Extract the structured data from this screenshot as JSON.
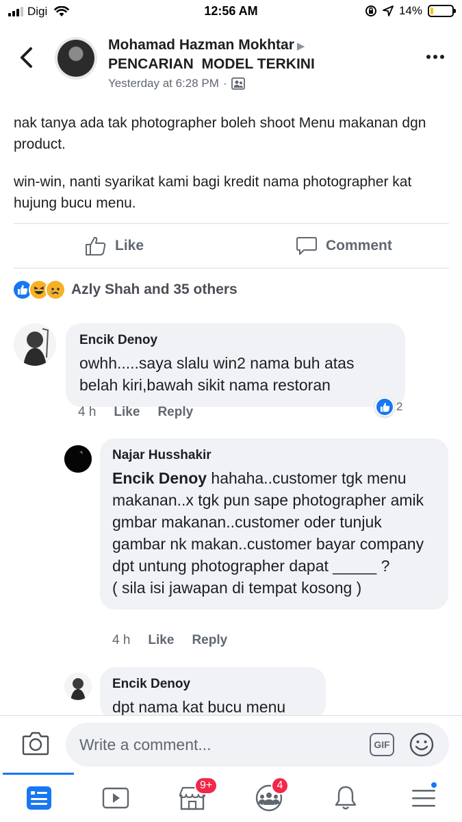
{
  "status_bar": {
    "carrier": "Digi",
    "time": "12:56 AM",
    "battery": "14%",
    "battery_level": 0.14,
    "battery_color": "#f5c400"
  },
  "header": {
    "back_icon": "chevron-left-icon",
    "author": "Mohamad Hazman Mokhtar",
    "arrow": "▶",
    "group": "PENCARIAN  MODEL TERKINI",
    "time": "Yesterday at 6:28 PM",
    "separator": "·",
    "privacy_icon": "members-icon",
    "more_icon": "more-icon"
  },
  "post": {
    "paragraphs": [
      "nak tanya ada tak photographer boleh shoot Menu makanan dgn product.",
      "win-win, nanti syarikat kami bagi kredit nama photographer kat hujung bucu menu."
    ]
  },
  "actions": {
    "like": "Like",
    "comment": "Comment"
  },
  "reactions": {
    "icons": [
      "like-reaction-icon",
      "haha-reaction-icon",
      "sad-reaction-icon"
    ],
    "summary": "Azly Shah and 35 others"
  },
  "comments": [
    {
      "name": "Encik Denoy",
      "text": "owhh.....saya slalu win2 nama buh atas belah kiri,bawah sikit nama restoran",
      "time": "4 h",
      "like": "Like",
      "reply": "Reply",
      "reaction_count": "2"
    },
    {
      "name": "Najar Husshakir",
      "mention": "Encik Denoy",
      "text": " hahaha..customer tgk menu makanan..x tgk pun sape photographer amik gmbar makanan..customer oder tunjuk gambar nk makan..customer bayar company dpt untung photographer dapat _____ ?",
      "text2": "( sila isi jawapan di tempat kosong )",
      "time": "4 h",
      "like": "Like",
      "reply": "Reply"
    },
    {
      "name": "Encik Denoy",
      "text": "dpt nama kat bucu menu"
    }
  ],
  "write_comment": {
    "placeholder": "Write a comment...",
    "gif": "GIF",
    "camera_icon": "camera-icon",
    "emoji_icon": "emoji-icon"
  },
  "tabbar": {
    "tabs": [
      {
        "icon": "news-feed-icon",
        "active": true
      },
      {
        "icon": "watch-icon"
      },
      {
        "icon": "marketplace-icon",
        "badge": "9+"
      },
      {
        "icon": "groups-icon",
        "badge": "4"
      },
      {
        "icon": "notifications-icon"
      },
      {
        "icon": "menu-icon",
        "dot": true
      }
    ],
    "accent": "#1877f2",
    "badge_color": "#f02849"
  }
}
